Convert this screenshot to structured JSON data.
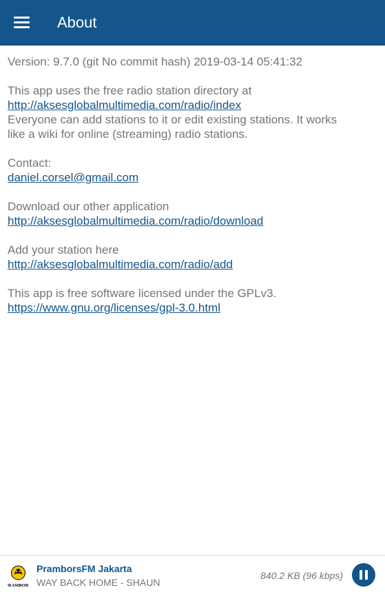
{
  "appbar": {
    "title": "About",
    "menu_icon": "hamburger-menu-icon",
    "background": "#14558b"
  },
  "about": {
    "version": "Version: 9.7.0 (git No commit hash) 2019-03-14 05:41:32",
    "directory_intro": "This app uses the free radio station directory at",
    "directory_link": "http://aksesglobalmultimedia.com/radio/index",
    "directory_desc_line1": "Everyone can add stations to it or edit existing stations. It works",
    "directory_desc_line2": "like a wiki for online (streaming) radio stations.",
    "contact_label": "Contact:",
    "contact_email": "daniel.corsel@gmail.com",
    "download_label": "Download our other application",
    "download_link": "http://aksesglobalmultimedia.com/radio/download",
    "add_label": "Add your station here",
    "add_link": "http://aksesglobalmultimedia.com/radio/add",
    "license_text": "This app is free software licensed under the GPLv3.",
    "license_link": "https://www.gnu.org/licenses/gpl-3.0.html"
  },
  "player": {
    "station_logo_icon": "prambors-logo-icon",
    "station_logo_text": "PRAMBORS",
    "station_name": "PramborsFM Jakarta",
    "track_title": "WAY BACK HOME - SHAUN",
    "stream_info": "840.2 KB (96 kbps)",
    "pause_icon": "pause-icon",
    "accent": "#14558b"
  }
}
